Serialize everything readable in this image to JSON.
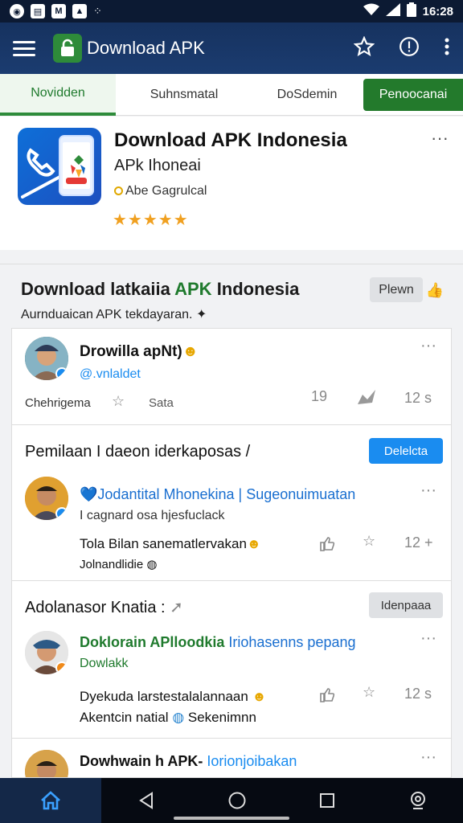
{
  "status": {
    "time": "16:28"
  },
  "appbar": {
    "title": "Download APK",
    "menu_icon": "hamburger-icon",
    "star_icon": "star-outline-icon",
    "info_icon": "info-icon",
    "more_icon": "more-vert-icon"
  },
  "tabs": [
    {
      "label": "Novidden",
      "active": true
    },
    {
      "label": "Suhnsmatal"
    },
    {
      "label": "DoSdemin"
    }
  ],
  "tab_cta": "Penoocanai",
  "hero": {
    "title": "Download APK Indonesia",
    "subtitle": "APk Ihoneai",
    "meta": "Abe Gagrulcal",
    "stars": "★★★★★",
    "more": "···"
  },
  "section": {
    "title_prefix": "Download latkaiia ",
    "title_green": "APK",
    "title_suffix": " Indonesia",
    "subtitle": "Aurnduaican APK tekdayaran.",
    "button": "Plewn"
  },
  "posts": [
    {
      "name": "Drowilla apNt)",
      "handle": "@.vnlaldet",
      "meta_left": "Chehrigema",
      "meta_mid": "Sata",
      "count1": "19",
      "count2": "12 s"
    }
  ],
  "group1": {
    "title": "Pemilaan I daeon iderkaposas /",
    "button": "Delelcta",
    "post": {
      "name": "Jodantital Mhonekina | Sugeonuimuatan",
      "handle": "I cagnard osa hjesfuclack",
      "text": "Tola Bilan sanematlervakan",
      "text2": "Jolnandlidie",
      "count": "12"
    }
  },
  "group2": {
    "title": "Adolanasor Knatia :",
    "button": "Idenpaaa",
    "post": {
      "name_prefix": "Doklorain ",
      "name_green": "APlloodkia",
      "name_blue": " Iriohasenns pepang",
      "handle": "Dowlakk",
      "text": "Dyekuda larstestalalannaan",
      "text2": "Akentcin natial",
      "text2b": "Sekenimnn",
      "count": "12 s"
    }
  },
  "post4": {
    "name_prefix": "Dowhwain h APK- ",
    "name_blue": "Iorionjoibakan"
  },
  "colors": {
    "accent": "#2e8b3a",
    "primary": "#1b3c70",
    "link": "#1a8cf0"
  }
}
